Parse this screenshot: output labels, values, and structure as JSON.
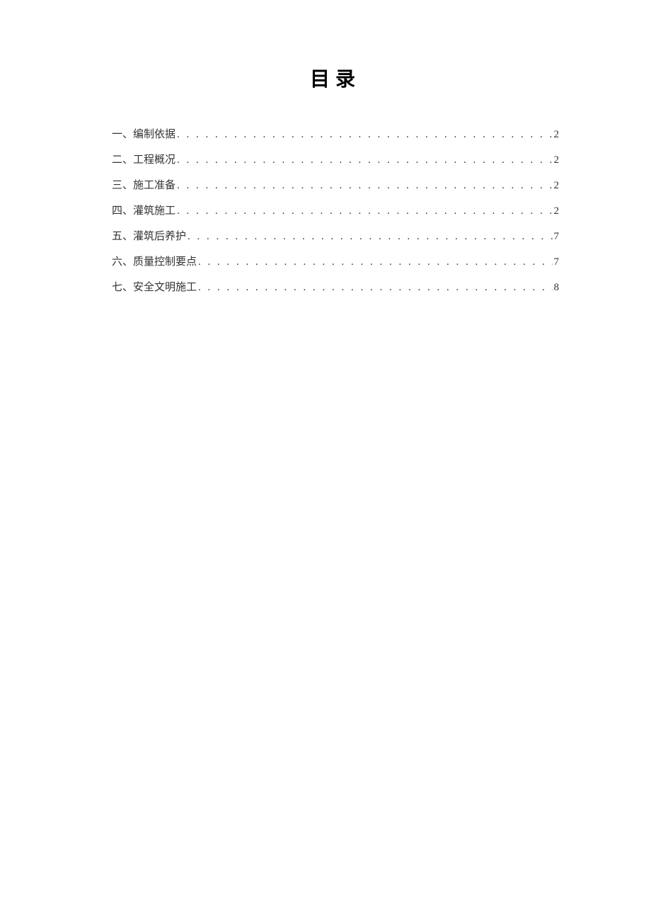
{
  "title": "目录",
  "toc": [
    {
      "label": "一、编制依据",
      "page": "2"
    },
    {
      "label": "二、工程概况",
      "page": "2"
    },
    {
      "label": "三、施工准备",
      "page": "2"
    },
    {
      "label": "四、灌筑施工",
      "page": "2"
    },
    {
      "label": "五、灌筑后养护",
      "page": "7"
    },
    {
      "label": "六、质量控制要点",
      "page": "7"
    },
    {
      "label": "七、安全文明施工",
      "page": "8"
    }
  ]
}
